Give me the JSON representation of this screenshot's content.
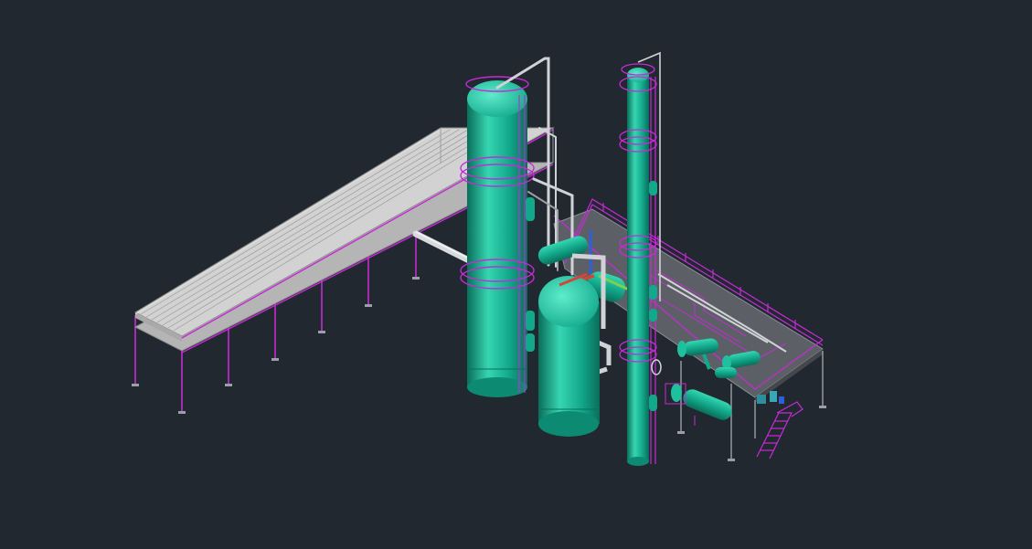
{
  "canvas": {
    "background": "#212830"
  },
  "colors": {
    "equipment_body": "#12a88b",
    "equipment_highlight": "#36d6b1",
    "equipment_shadow": "#0a6e5a",
    "railing_magenta": "#c62ad6",
    "walkway_gray": "#c8c8c8",
    "walkway_line": "#8f8f8f",
    "pipe_light": "#cfd3d6",
    "steel_gray": "#9aa0a6",
    "floor_gray": "#5c6066",
    "line_blue": "#2f5fd6",
    "line_green": "#7ed04b",
    "line_red": "#d2453a"
  },
  "objects": {
    "walkway": "pipe-rack-walkway",
    "column_1": "large-distillation-column",
    "column_2": "tall-slender-column",
    "drum": "vertical-drum-vessel",
    "platform": "equipment-platform",
    "exchangers": [
      "shell-tube-exchanger",
      "shell-tube-exchanger",
      "shell-tube-exchanger",
      "horizontal-exchanger"
    ],
    "stair": "access-stair"
  }
}
